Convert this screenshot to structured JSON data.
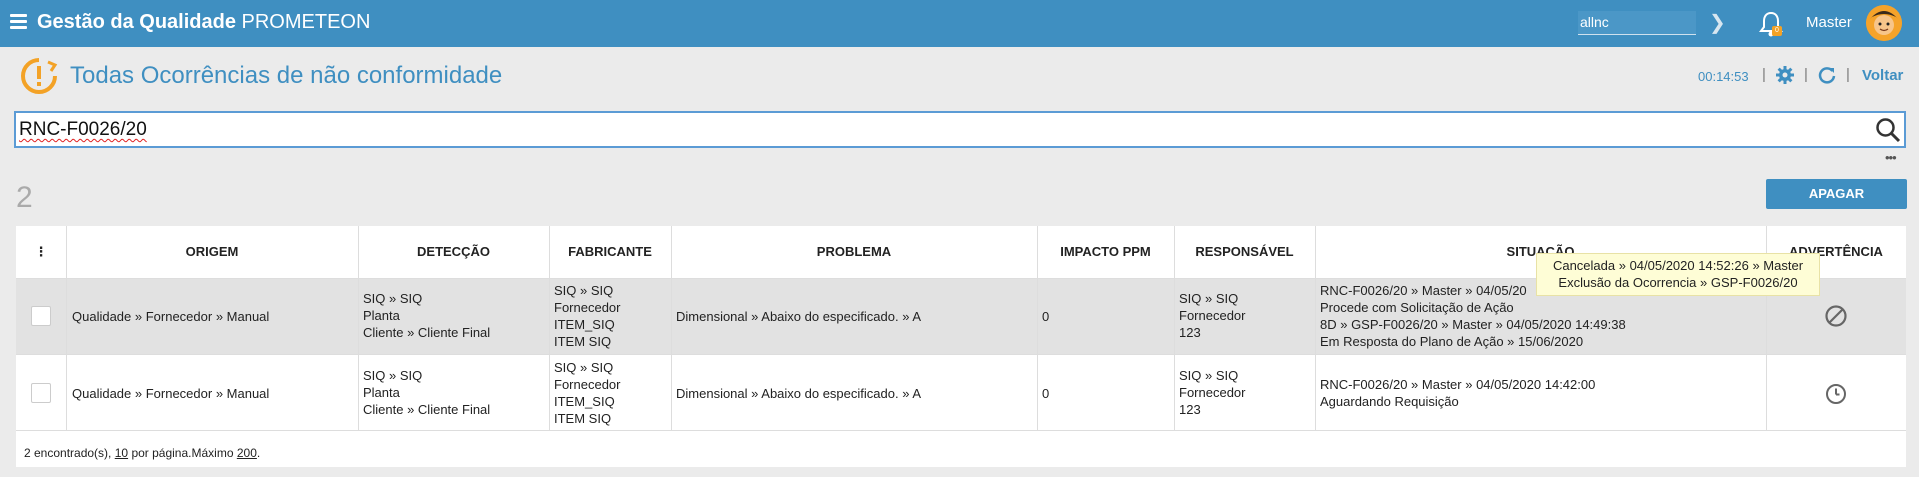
{
  "header": {
    "brand_bold": "Gestão da Qualidade",
    "brand_rest": "PROMETEON",
    "search_value": "allnc",
    "user_name": "Master"
  },
  "page": {
    "title": "Todas Ocorrências de não conformidade",
    "timer": "00:14:53",
    "back_label": "Voltar",
    "search_value": "RNC-F0026/20",
    "result_count": "2",
    "delete_button": "APAGAR"
  },
  "table": {
    "columns": [
      "ORIGEM",
      "DETECÇÃO",
      "FABRICANTE",
      "PROBLEMA",
      "IMPACTO PPM",
      "RESPONSÁVEL",
      "SITUAÇÃO",
      "ADVERTÊNCIA"
    ],
    "rows": [
      {
        "origem": "Qualidade » Fornecedor » Manual",
        "deteccao": [
          "SIQ » SIQ",
          "Planta",
          "Cliente » Cliente Final"
        ],
        "fabricante": [
          "SIQ » SIQ",
          "Fornecedor",
          "ITEM_SIQ",
          "ITEM SIQ"
        ],
        "problema": "Dimensional » Abaixo do especificado. » A",
        "impacto": "0",
        "responsavel": [
          "SIQ » SIQ",
          "Fornecedor",
          "123"
        ],
        "situacao": [
          "RNC-F0026/20 » Master » 04/05/20",
          "Procede com Solicitação de Ação",
          "8D » GSP-F0026/20 » Master » 04/05/2020 14:49:38",
          "Em Resposta do Plano de Ação » 15/06/2020"
        ],
        "advertencia_icon": "cancel-icon"
      },
      {
        "origem": "Qualidade » Fornecedor » Manual",
        "deteccao": [
          "SIQ » SIQ",
          "Planta",
          "Cliente » Cliente Final"
        ],
        "fabricante": [
          "SIQ » SIQ",
          "Fornecedor",
          "ITEM_SIQ",
          "ITEM SIQ"
        ],
        "problema": "Dimensional » Abaixo do especificado. » A",
        "impacto": "0",
        "responsavel": [
          "SIQ » SIQ",
          "Fornecedor",
          "123"
        ],
        "situacao": [
          "RNC-F0026/20 » Master » 04/05/2020 14:42:00",
          "Aguardando Requisição"
        ],
        "advertencia_icon": "clock-icon"
      }
    ]
  },
  "tooltip": {
    "line1": "Cancelada » 04/05/2020 14:52:26 » Master",
    "line2": "Exclusão da Ocorrencia » GSP-F0026/20"
  },
  "footer": {
    "found": "2 encontrado(s),",
    "per_page": "10",
    "per_page_label": "por página.Máximo",
    "max": "200",
    "end": "."
  },
  "colors": {
    "accent": "#3f8fc1",
    "warning": "#f3a226"
  }
}
